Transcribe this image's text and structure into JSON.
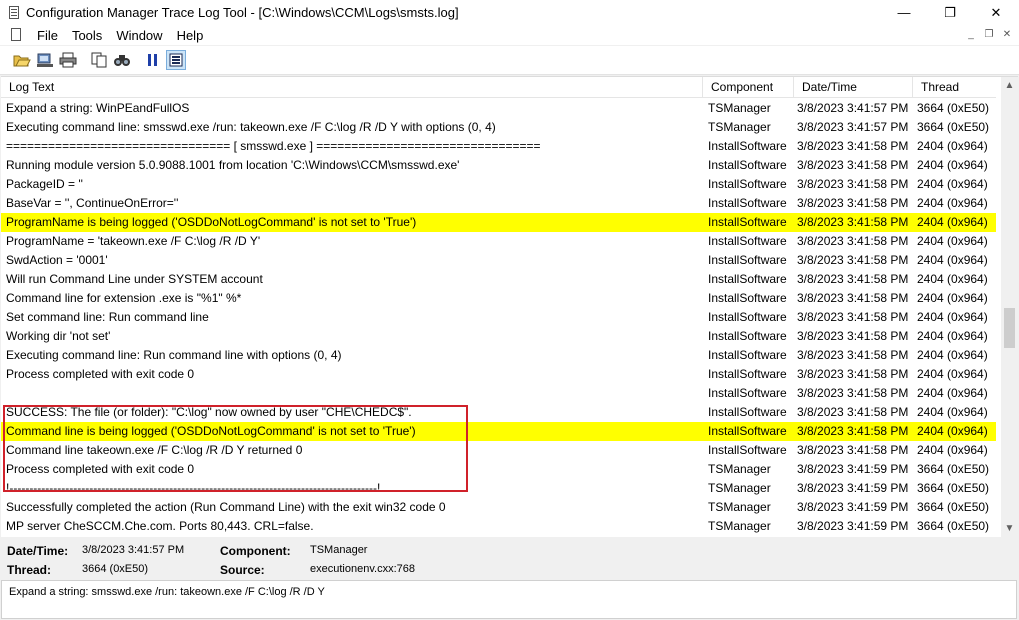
{
  "window": {
    "title": "Configuration Manager Trace Log Tool - [C:\\Windows\\CCM\\Logs\\smsts.log]",
    "controls": {
      "minimize": "—",
      "maximize": "❐",
      "close": "✕"
    },
    "mdi_controls": {
      "minimize": "_",
      "restore": "❐",
      "close": "✕"
    }
  },
  "menu": [
    "File",
    "Tools",
    "Window",
    "Help"
  ],
  "toolbar": [
    "open-icon",
    "open-server-icon",
    "print-icon",
    "copy-icon",
    "find-icon",
    "pause-icon",
    "highlight-icon"
  ],
  "columns": {
    "text": "Log Text",
    "component": "Component",
    "datetime": "Date/Time",
    "thread": "Thread"
  },
  "rows": [
    {
      "text": "Expand a string: WinPEandFullOS",
      "component": "TSManager",
      "datetime": "3/8/2023 3:41:57 PM",
      "thread": "3664 (0xE50)",
      "hl": false
    },
    {
      "text": "Executing command line: smsswd.exe /run: takeown.exe /F C:\\log /R /D Y with options (0, 4)",
      "component": "TSManager",
      "datetime": "3/8/2023 3:41:57 PM",
      "thread": "3664 (0xE50)",
      "hl": false
    },
    {
      "text": "================================ [ smsswd.exe ] ================================",
      "component": "InstallSoftware",
      "datetime": "3/8/2023 3:41:58 PM",
      "thread": "2404 (0x964)",
      "hl": false
    },
    {
      "text": "Running module version 5.0.9088.1001 from location 'C:\\Windows\\CCM\\smsswd.exe'",
      "component": "InstallSoftware",
      "datetime": "3/8/2023 3:41:58 PM",
      "thread": "2404 (0x964)",
      "hl": false
    },
    {
      "text": "PackageID = ''",
      "component": "InstallSoftware",
      "datetime": "3/8/2023 3:41:58 PM",
      "thread": "2404 (0x964)",
      "hl": false
    },
    {
      "text": "BaseVar = '', ContinueOnError=''",
      "component": "InstallSoftware",
      "datetime": "3/8/2023 3:41:58 PM",
      "thread": "2404 (0x964)",
      "hl": false
    },
    {
      "text": "ProgramName is being logged ('OSDDoNotLogCommand' is not set to 'True')",
      "component": "InstallSoftware",
      "datetime": "3/8/2023 3:41:58 PM",
      "thread": "2404 (0x964)",
      "hl": true
    },
    {
      "text": "ProgramName = 'takeown.exe /F C:\\log /R /D Y'",
      "component": "InstallSoftware",
      "datetime": "3/8/2023 3:41:58 PM",
      "thread": "2404 (0x964)",
      "hl": false
    },
    {
      "text": "SwdAction = '0001'",
      "component": "InstallSoftware",
      "datetime": "3/8/2023 3:41:58 PM",
      "thread": "2404 (0x964)",
      "hl": false
    },
    {
      "text": "Will run Command Line under SYSTEM account",
      "component": "InstallSoftware",
      "datetime": "3/8/2023 3:41:58 PM",
      "thread": "2404 (0x964)",
      "hl": false
    },
    {
      "text": "Command line for extension .exe is \"%1\" %*",
      "component": "InstallSoftware",
      "datetime": "3/8/2023 3:41:58 PM",
      "thread": "2404 (0x964)",
      "hl": false
    },
    {
      "text": "Set command line: Run command line",
      "component": "InstallSoftware",
      "datetime": "3/8/2023 3:41:58 PM",
      "thread": "2404 (0x964)",
      "hl": false
    },
    {
      "text": "Working dir 'not set'",
      "component": "InstallSoftware",
      "datetime": "3/8/2023 3:41:58 PM",
      "thread": "2404 (0x964)",
      "hl": false
    },
    {
      "text": "Executing command line: Run command line with options (0, 4)",
      "component": "InstallSoftware",
      "datetime": "3/8/2023 3:41:58 PM",
      "thread": "2404 (0x964)",
      "hl": false
    },
    {
      "text": "Process completed with exit code 0",
      "component": "InstallSoftware",
      "datetime": "3/8/2023 3:41:58 PM",
      "thread": "2404 (0x964)",
      "hl": false
    },
    {
      "text": "",
      "component": "InstallSoftware",
      "datetime": "3/8/2023 3:41:58 PM",
      "thread": "2404 (0x964)",
      "hl": false
    },
    {
      "text": "SUCCESS: The file (or folder): \"C:\\log\" now owned by user \"CHE\\CHEDC$\".",
      "component": "InstallSoftware",
      "datetime": "3/8/2023 3:41:58 PM",
      "thread": "2404 (0x964)",
      "hl": false
    },
    {
      "text": "Command line is being logged ('OSDDoNotLogCommand' is not set to 'True')",
      "component": "InstallSoftware",
      "datetime": "3/8/2023 3:41:58 PM",
      "thread": "2404 (0x964)",
      "hl": true
    },
    {
      "text": "Command line takeown.exe /F C:\\log /R /D Y returned 0",
      "component": "InstallSoftware",
      "datetime": "3/8/2023 3:41:58 PM",
      "thread": "2404 (0x964)",
      "hl": false
    },
    {
      "text": "Process completed with exit code 0",
      "component": "TSManager",
      "datetime": "3/8/2023 3:41:59 PM",
      "thread": "3664 (0xE50)",
      "hl": false
    },
    {
      "text": "!--------------------------------------------------------------------------------------------!",
      "component": "TSManager",
      "datetime": "3/8/2023 3:41:59 PM",
      "thread": "3664 (0xE50)",
      "hl": false
    },
    {
      "text": "Successfully completed the action (Run Command Line) with the exit win32 code 0",
      "component": "TSManager",
      "datetime": "3/8/2023 3:41:59 PM",
      "thread": "3664 (0xE50)",
      "hl": false
    },
    {
      "text": "MP server CheSCCM.Che.com. Ports 80,443. CRL=false.",
      "component": "TSManager",
      "datetime": "3/8/2023 3:41:59 PM",
      "thread": "3664 (0xE50)",
      "hl": false
    }
  ],
  "details": {
    "datetime_label": "Date/Time:",
    "datetime_value": "3/8/2023 3:41:57 PM",
    "component_label": "Component:",
    "component_value": "TSManager",
    "thread_label": "Thread:",
    "thread_value": "3664 (0xE50)",
    "source_label": "Source:",
    "source_value": "executionenv.cxx:768"
  },
  "message": "Expand a string: smsswd.exe /run: takeown.exe /F C:\\log /R /D Y",
  "colors": {
    "highlight": "#ffff00",
    "annotation_box": "#d0212a"
  }
}
